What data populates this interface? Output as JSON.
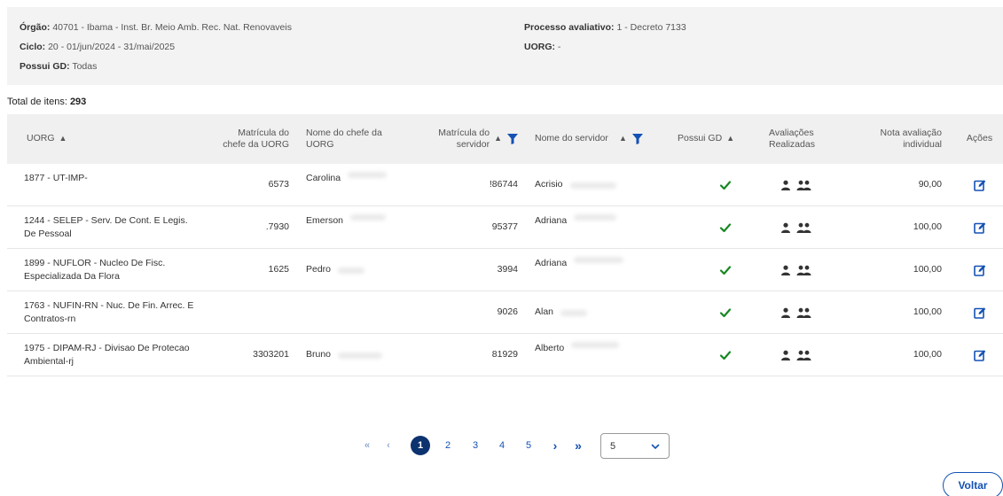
{
  "filters": {
    "orgao_label": "Órgão:",
    "orgao_value": "40701 - Ibama - Inst. Br. Meio Amb. Rec. Nat. Renovaveis",
    "ciclo_label": "Ciclo:",
    "ciclo_value": "20 - 01/jun/2024 - 31/mai/2025",
    "possui_gd_label": "Possui GD:",
    "possui_gd_value": "Todas",
    "processo_label": "Processo avaliativo:",
    "processo_value": "1 - Decreto 7133",
    "uorg_label": "UORG:",
    "uorg_value": "-"
  },
  "total": {
    "label": "Total de itens:",
    "value": "293"
  },
  "table": {
    "headers": {
      "uorg": "UORG",
      "matricula_chefe": "Matrícula do chefe da UORG",
      "nome_chefe": "Nome do chefe da UORG",
      "matricula_servidor": "Matrícula do servidor",
      "nome_servidor": "Nome do servidor",
      "possui_gd": "Possui GD",
      "avaliacoes": "Avaliações Realizadas",
      "nota": "Nota avaliação individual",
      "acoes": "Ações"
    },
    "rows": [
      {
        "uorg": "1877 - UT-IMP-",
        "matricula_chefe": "6573",
        "nome_chefe": "Carolina",
        "matricula_servidor": "!86744",
        "nome_servidor": "Acrisio",
        "nota": "90,00"
      },
      {
        "uorg": "1244 - SELEP - Serv. De Cont. E Legis. De Pessoal",
        "matricula_chefe": ".7930",
        "nome_chefe": "Emerson",
        "matricula_servidor": "95377",
        "nome_servidor": "Adriana",
        "nota": "100,00"
      },
      {
        "uorg": "1899 - NUFLOR - Nucleo De Fisc. Especializada Da Flora",
        "matricula_chefe": "1625",
        "nome_chefe": "Pedro",
        "matricula_servidor": "3994",
        "nome_servidor": "Adriana",
        "nota": "100,00"
      },
      {
        "uorg": "1763 - NUFIN-RN - Nuc. De Fin. Arrec. E Contratos-rn",
        "matricula_chefe": "",
        "nome_chefe": "",
        "matricula_servidor": "9026",
        "nome_servidor": "Alan",
        "nota": "100,00"
      },
      {
        "uorg": "1975 - DIPAM-RJ - Divisao De Protecao Ambiental-rj",
        "matricula_chefe": "3303201",
        "nome_chefe": "Bruno",
        "matricula_servidor": "81929",
        "nome_servidor": "Alberto",
        "nota": "100,00"
      }
    ]
  },
  "icons": {
    "sort": "sort-icon",
    "sort_asc": "sort-asc-icon",
    "filter": "filter-icon",
    "check": "check-icon",
    "user": "user-icon",
    "users": "users-icon",
    "edit": "edit-icon",
    "first": "double-chevron-left-icon",
    "prev": "chevron-left-icon",
    "next": "chevron-right-icon",
    "last": "double-chevron-right-icon"
  },
  "pagination": {
    "first": "«",
    "prev": "‹",
    "pages": [
      "1",
      "2",
      "3",
      "4",
      "5"
    ],
    "current": "1",
    "next": "›",
    "last": "»",
    "page_size": "5"
  },
  "actions": {
    "voltar": "Voltar"
  },
  "colors": {
    "primary": "#1351b4",
    "active_page": "#0c326f",
    "check": "#168821",
    "panel_bg": "#f3f3f3",
    "header_bg": "#f0f0f0"
  }
}
